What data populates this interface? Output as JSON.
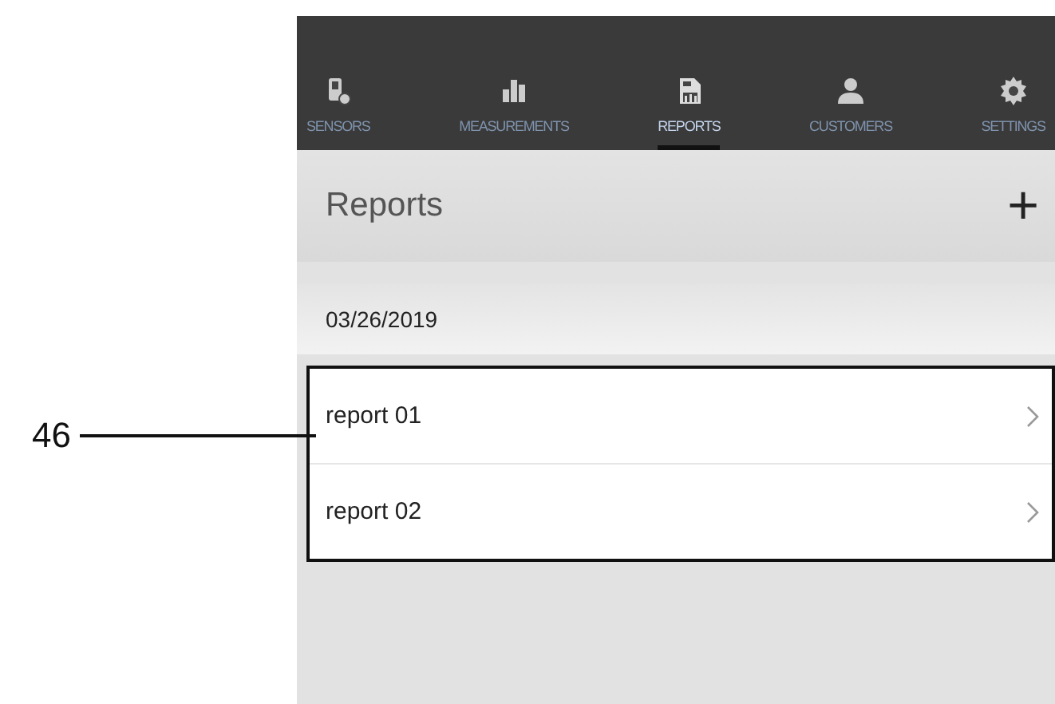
{
  "tabs": [
    {
      "label": "SENSORS",
      "kind": "sensor",
      "selected": false
    },
    {
      "label": "MEASUREMENTS",
      "kind": "bars",
      "selected": false
    },
    {
      "label": "REPORTS",
      "kind": "report",
      "selected": true
    },
    {
      "label": "CUSTOMERS",
      "kind": "person",
      "selected": false
    },
    {
      "label": "SETTINGS",
      "kind": "gear",
      "selected": false
    }
  ],
  "header": {
    "title": "Reports",
    "add_button": "+"
  },
  "section": {
    "date": "03/26/2019"
  },
  "reports": [
    {
      "label": "report 01"
    },
    {
      "label": "report 02"
    }
  ],
  "callout": {
    "label": "46"
  }
}
